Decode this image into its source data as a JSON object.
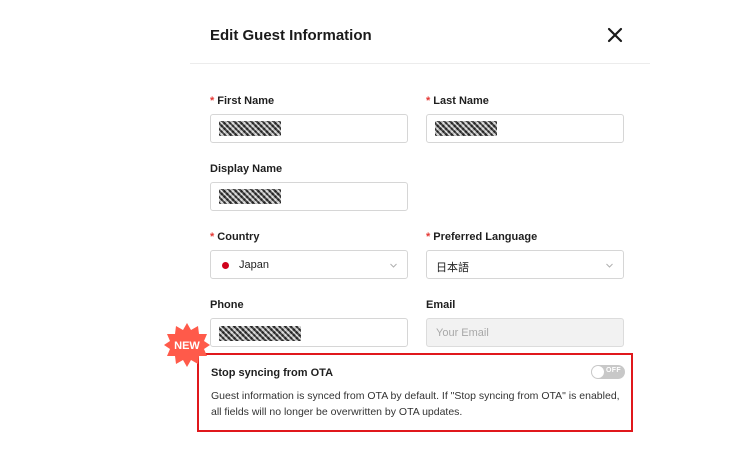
{
  "modal": {
    "title": "Edit Guest Information"
  },
  "form": {
    "first_name": {
      "label": "First Name",
      "required_mark": "*",
      "value_redacted": true
    },
    "last_name": {
      "label": "Last Name",
      "required_mark": "*",
      "value_redacted": true
    },
    "display_name": {
      "label": "Display Name",
      "value_redacted": true
    },
    "country": {
      "label": "Country",
      "required_mark": "*",
      "value": "Japan"
    },
    "preferred_language": {
      "label": "Preferred Language",
      "required_mark": "*",
      "value": "日本語"
    },
    "phone": {
      "label": "Phone",
      "value_redacted": true
    },
    "email": {
      "label": "Email",
      "placeholder": "Your Email"
    }
  },
  "ota": {
    "title": "Stop syncing from OTA",
    "toggle_state": "OFF",
    "description": "Guest information is synced from OTA by default. If \"Stop syncing from OTA\" is enabled, all fields will no longer be overwritten by OTA updates."
  },
  "badge": {
    "text": "NEW"
  },
  "colors": {
    "required": "#e53935",
    "highlight_border": "#e0181c",
    "badge": "#ff5a4a",
    "toggle_off": "#c8c8c8"
  },
  "icons": {
    "close": "close-icon",
    "chevron": "chevron-down-icon",
    "flag": "japan-flag-icon"
  }
}
